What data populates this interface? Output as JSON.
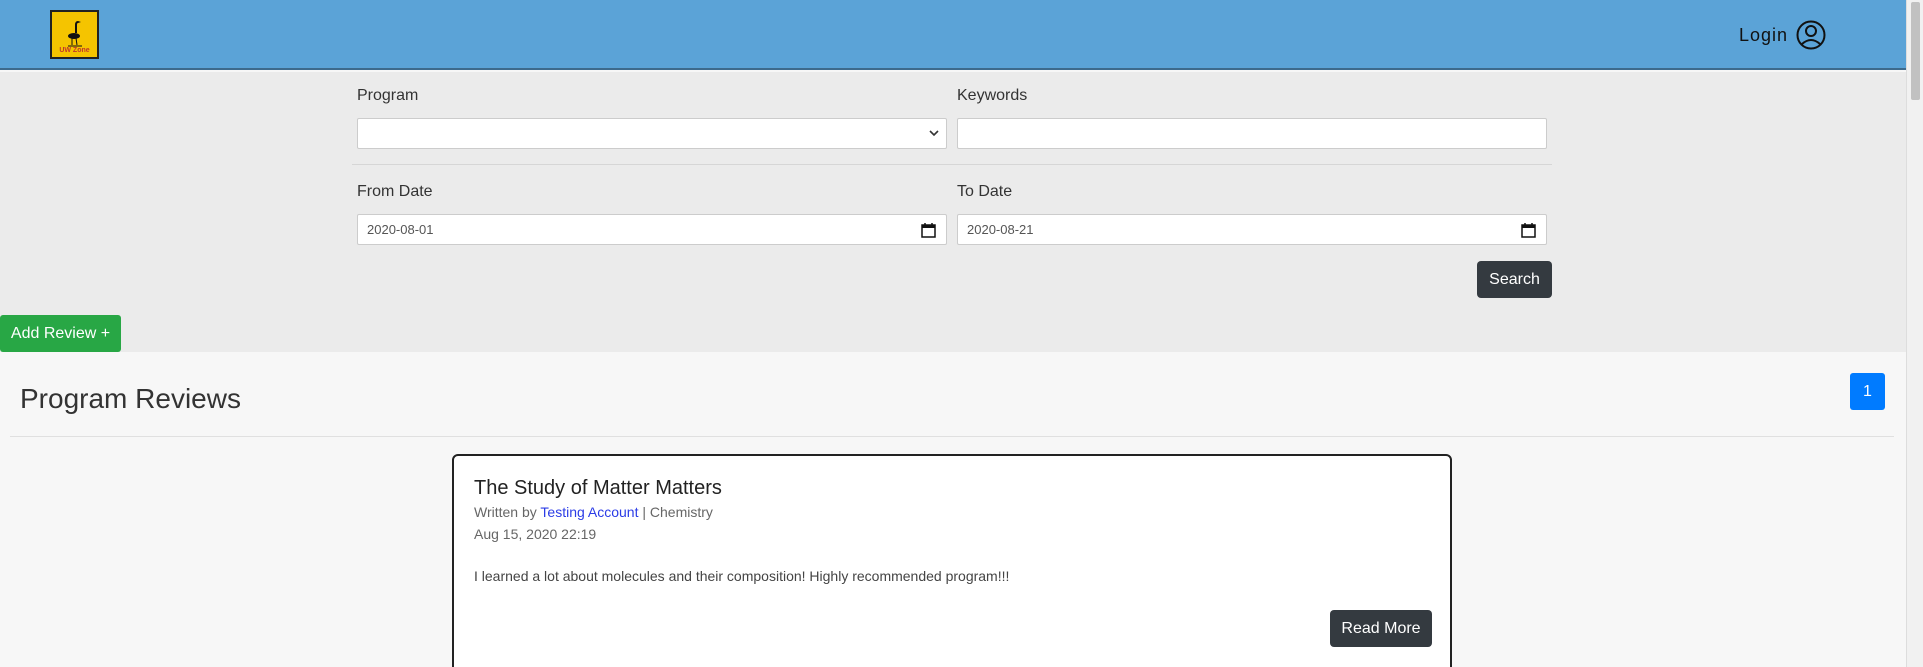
{
  "navbar": {
    "logo_text": "UW Zone",
    "login_label": "Login"
  },
  "filters": {
    "program_label": "Program",
    "program_value": "",
    "keywords_label": "Keywords",
    "keywords_value": "",
    "from_label": "From Date",
    "from_value": "2020-08-01",
    "to_label": "To Date",
    "to_value": "2020-08-21",
    "search_label": "Search"
  },
  "add_review_label": "Add Review +",
  "reviews": {
    "title": "Program Reviews",
    "page": "1",
    "items": [
      {
        "title": "The Study of Matter Matters",
        "written_by": "Written by",
        "author": "Testing Account",
        "separator": "|",
        "program": "Chemistry",
        "date": "Aug 15, 2020 22:19",
        "body": "I learned a lot about molecules and their composition! Highly recommended program!!!",
        "read_more": "Read More"
      }
    ]
  },
  "colors": {
    "navbar": "#5ba3d7",
    "accent_green": "#28a745",
    "accent_blue": "#007bff",
    "dark_button": "#343a40",
    "author_link": "#2b3ce6"
  }
}
